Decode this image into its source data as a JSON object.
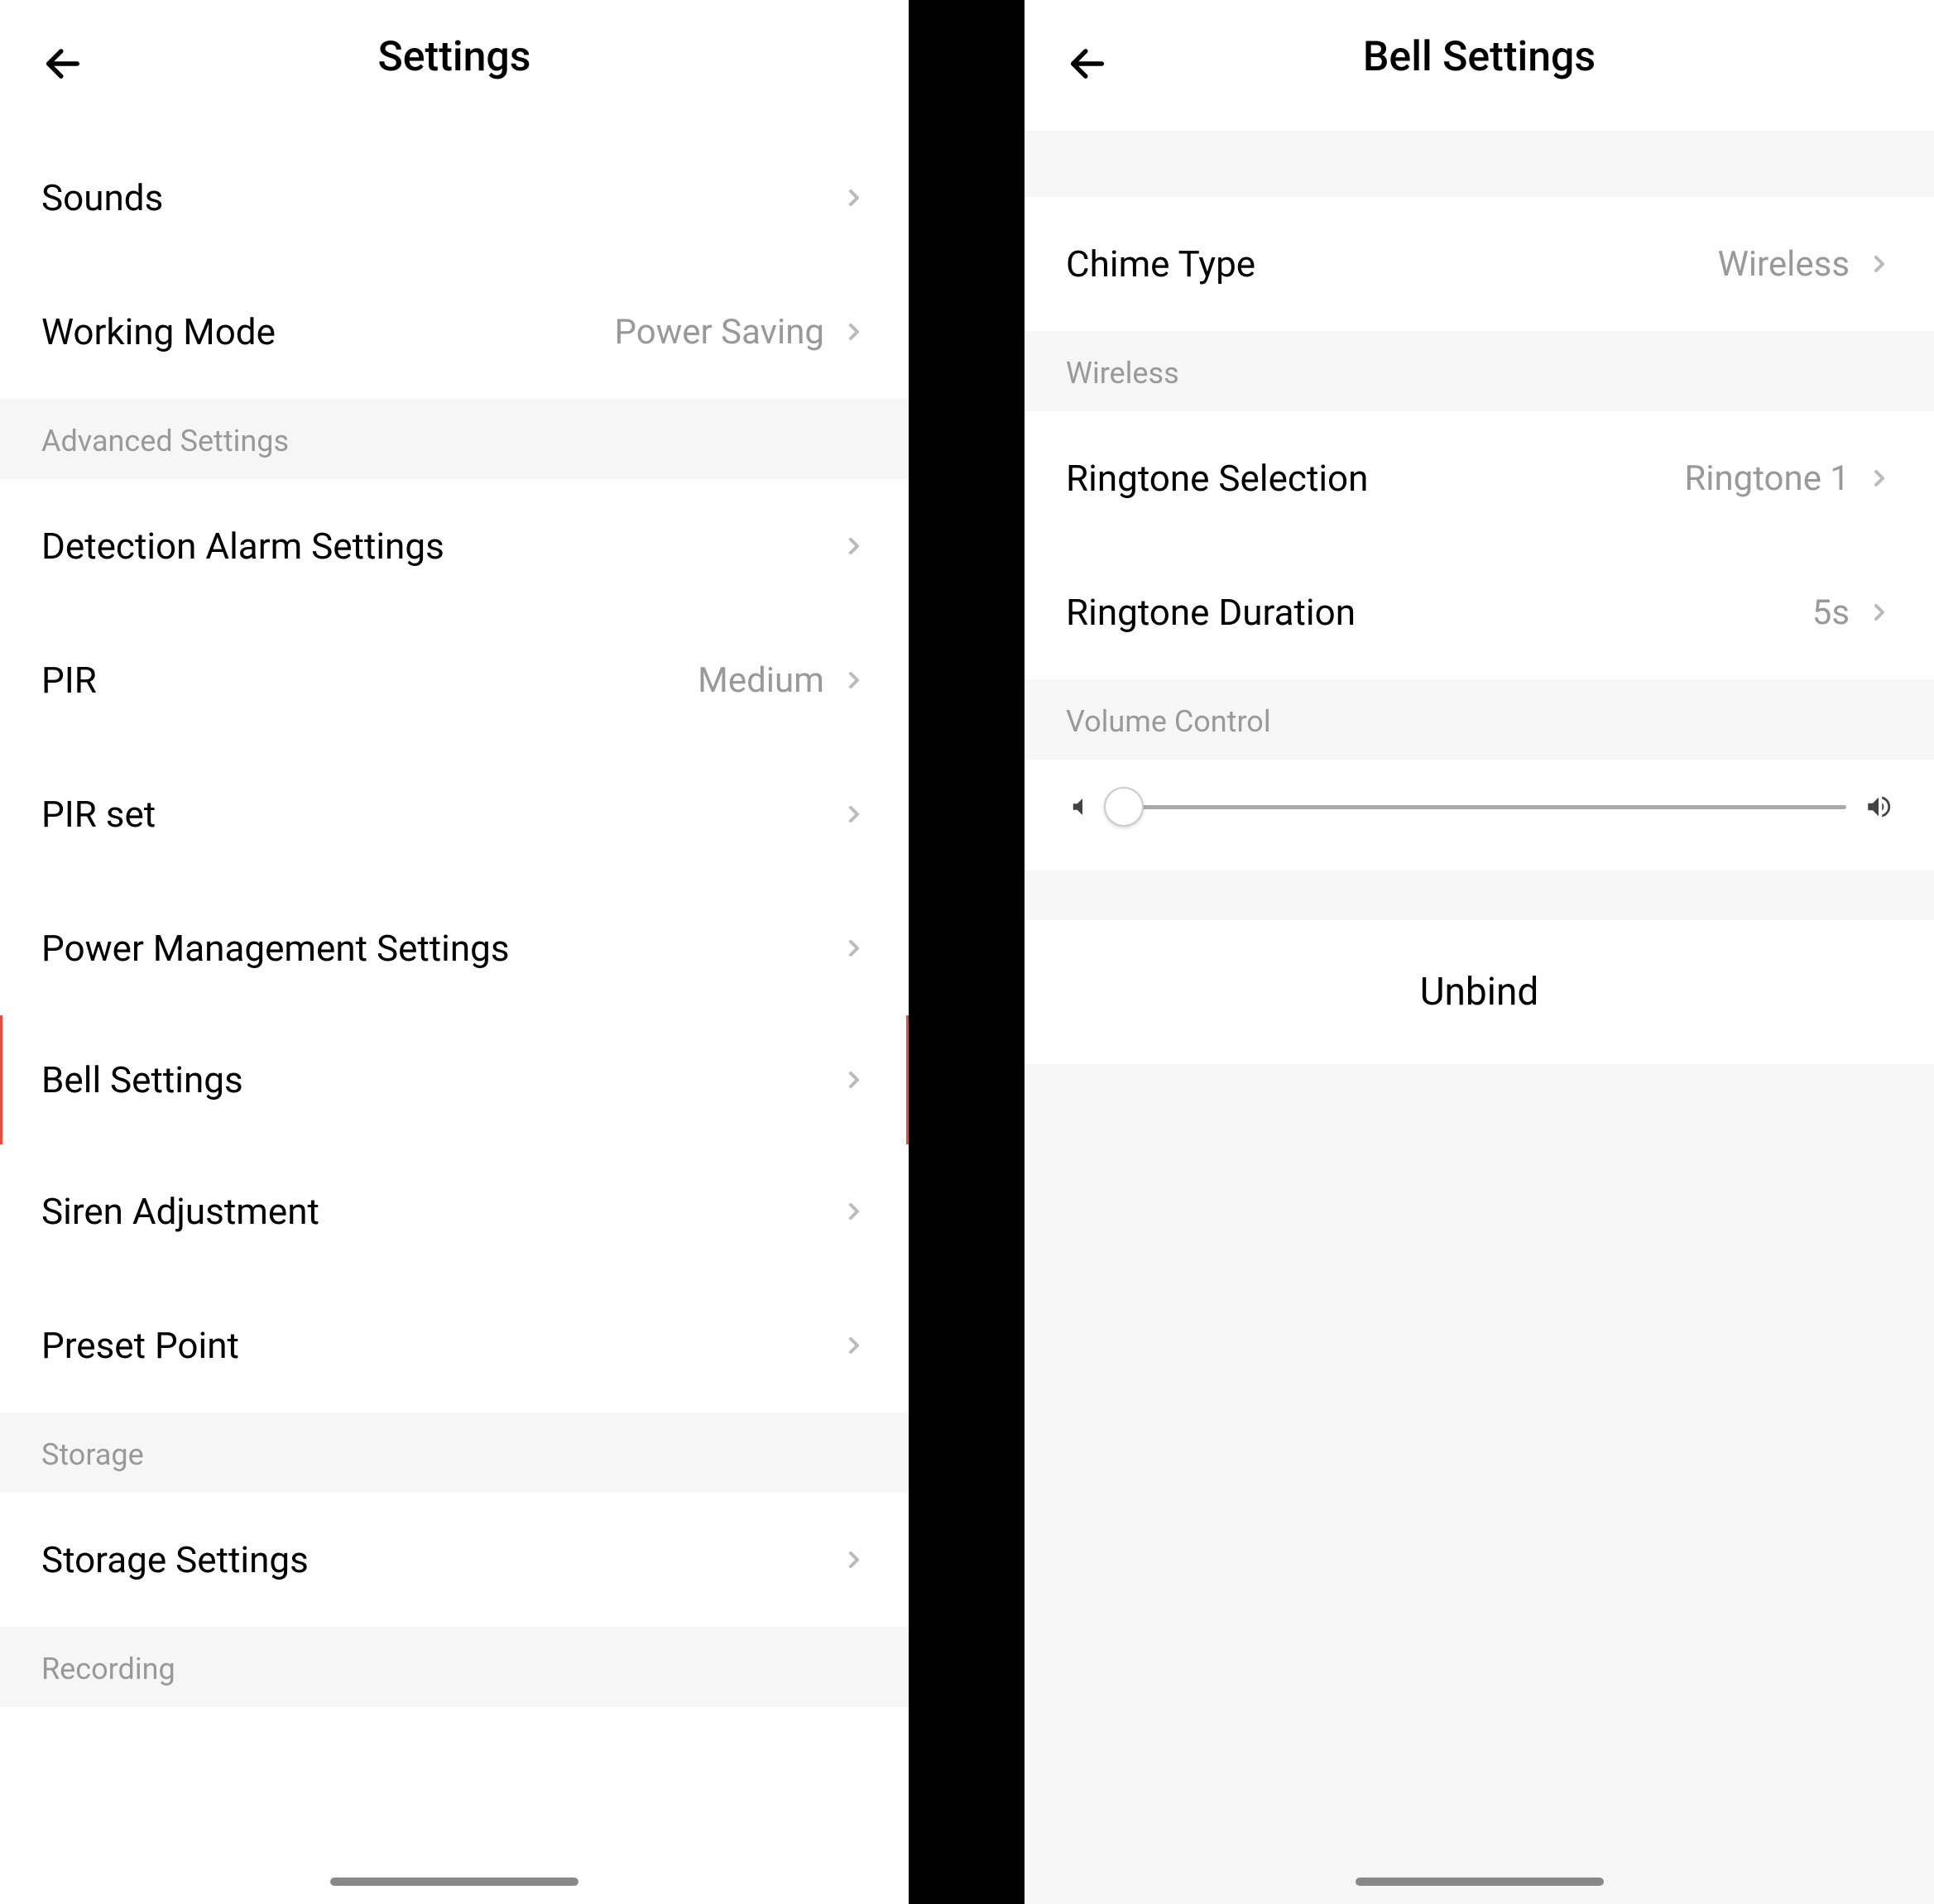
{
  "left": {
    "header": {
      "title": "Settings"
    },
    "rows": {
      "sounds": {
        "label": "Sounds"
      },
      "working_mode": {
        "label": "Working Mode",
        "value": "Power Saving"
      }
    },
    "section_advanced": "Advanced Settings",
    "advanced_rows": {
      "detection_alarm": {
        "label": "Detection Alarm Settings"
      },
      "pir": {
        "label": "PIR",
        "value": "Medium"
      },
      "pir_set": {
        "label": "PIR set"
      },
      "power_mgmt": {
        "label": "Power Management Settings"
      },
      "bell_settings": {
        "label": "Bell Settings"
      },
      "siren_adjust": {
        "label": "Siren Adjustment"
      },
      "preset_point": {
        "label": "Preset Point"
      }
    },
    "section_storage": "Storage",
    "storage_rows": {
      "storage_settings": {
        "label": "Storage Settings"
      }
    },
    "section_recording": "Recording"
  },
  "right": {
    "header": {
      "title": "Bell Settings"
    },
    "chime_type": {
      "label": "Chime Type",
      "value": "Wireless"
    },
    "section_wireless": "Wireless",
    "ringtone_selection": {
      "label": "Ringtone Selection",
      "value": "Ringtone 1"
    },
    "ringtone_duration": {
      "label": "Ringtone Duration",
      "value": "5s"
    },
    "section_volume": "Volume Control",
    "volume_position_percent": 2,
    "unbind": {
      "label": "Unbind"
    }
  }
}
